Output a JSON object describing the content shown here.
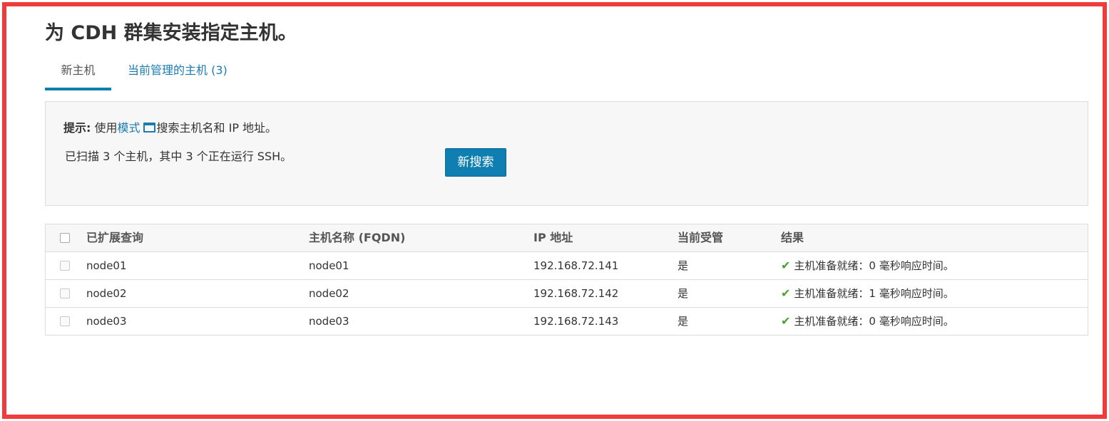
{
  "page": {
    "title": "为 CDH 群集安装指定主机。"
  },
  "tabs": [
    {
      "label": "新主机",
      "active": true
    },
    {
      "label": "当前管理的主机 (3)",
      "active": false
    }
  ],
  "info": {
    "hint_label": "提示:",
    "hint_prefix": " 使用",
    "hint_link": "模式",
    "hint_icon": "window-icon",
    "hint_suffix": "搜索主机名和 IP 地址。",
    "scan_text": "已扫描 3 个主机，其中 3 个正在运行 SSH。",
    "new_search_label": "新搜索"
  },
  "table": {
    "headers": [
      "已扩展查询",
      "主机名称 (FQDN)",
      "IP 地址",
      "当前受管",
      "结果"
    ],
    "rows": [
      {
        "query": "node01",
        "fqdn": "node01",
        "ip": "192.168.72.141",
        "managed": "是",
        "result": "主机准备就绪：0 毫秒响应时间。",
        "checked": false
      },
      {
        "query": "node02",
        "fqdn": "node02",
        "ip": "192.168.72.142",
        "managed": "是",
        "result": "主机准备就绪：1 毫秒响应时间。",
        "checked": false
      },
      {
        "query": "node03",
        "fqdn": "node03",
        "ip": "192.168.72.143",
        "managed": "是",
        "result": "主机准备就绪：0 毫秒响应时间。",
        "checked": false
      }
    ]
  },
  "colors": {
    "accent": "#0e7fb0",
    "link": "#1a7bb0",
    "success": "#4aa02c",
    "frame": "#ef3b3b"
  }
}
